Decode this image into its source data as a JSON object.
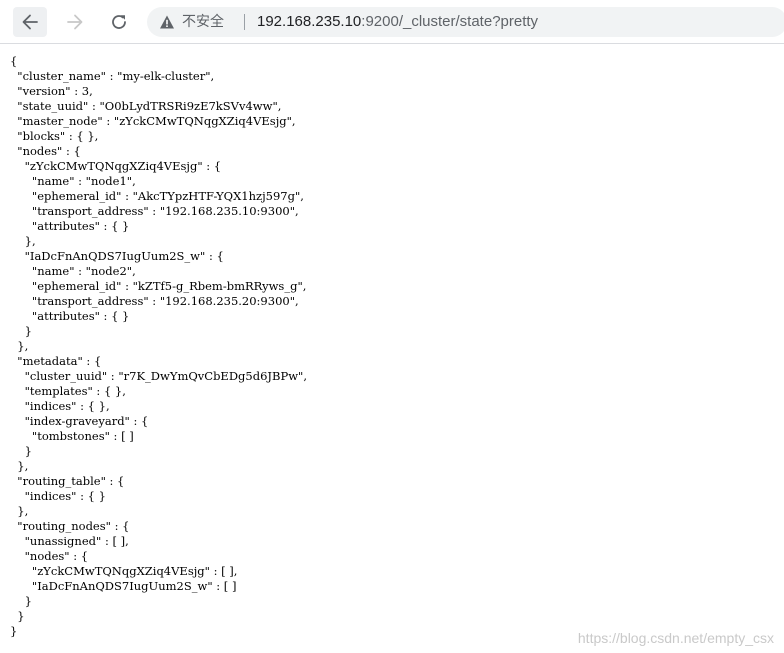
{
  "browser": {
    "security_label": "不安全",
    "url_host": "192.168.235.10",
    "url_rest": ":9200/_cluster/state?pretty",
    "icons": {
      "back": "arrow-left-icon",
      "forward": "arrow-right-icon",
      "reload": "reload-icon",
      "security": "warning-triangle-icon"
    }
  },
  "response": {
    "lines": [
      "{",
      "  \"cluster_name\" : \"my-elk-cluster\",",
      "  \"version\" : 3,",
      "  \"state_uuid\" : \"O0bLydTRSRi9zE7kSVv4ww\",",
      "  \"master_node\" : \"zYckCMwTQNqgXZiq4VEsjg\",",
      "  \"blocks\" : { },",
      "  \"nodes\" : {",
      "    \"zYckCMwTQNqgXZiq4VEsjg\" : {",
      "      \"name\" : \"node1\",",
      "      \"ephemeral_id\" : \"AkcTYpzHTF-YQX1hzj597g\",",
      "      \"transport_address\" : \"192.168.235.10:9300\",",
      "      \"attributes\" : { }",
      "    },",
      "    \"IaDcFnAnQDS7IugUum2S_w\" : {",
      "      \"name\" : \"node2\",",
      "      \"ephemeral_id\" : \"kZTf5-g_Rbem-bmRRyws_g\",",
      "      \"transport_address\" : \"192.168.235.20:9300\",",
      "      \"attributes\" : { }",
      "    }",
      "  },",
      "  \"metadata\" : {",
      "    \"cluster_uuid\" : \"r7K_DwYmQvCbEDg5d6JBPw\",",
      "    \"templates\" : { },",
      "    \"indices\" : { },",
      "    \"index-graveyard\" : {",
      "      \"tombstones\" : [ ]",
      "    }",
      "  },",
      "  \"routing_table\" : {",
      "    \"indices\" : { }",
      "  },",
      "  \"routing_nodes\" : {",
      "    \"unassigned\" : [ ],",
      "    \"nodes\" : {",
      "      \"zYckCMwTQNqgXZiq4VEsjg\" : [ ],",
      "      \"IaDcFnAnQDS7IugUum2S_w\" : [ ]",
      "    }",
      "  }",
      "}"
    ]
  },
  "watermark": "https://blog.csdn.net/empty_csx"
}
